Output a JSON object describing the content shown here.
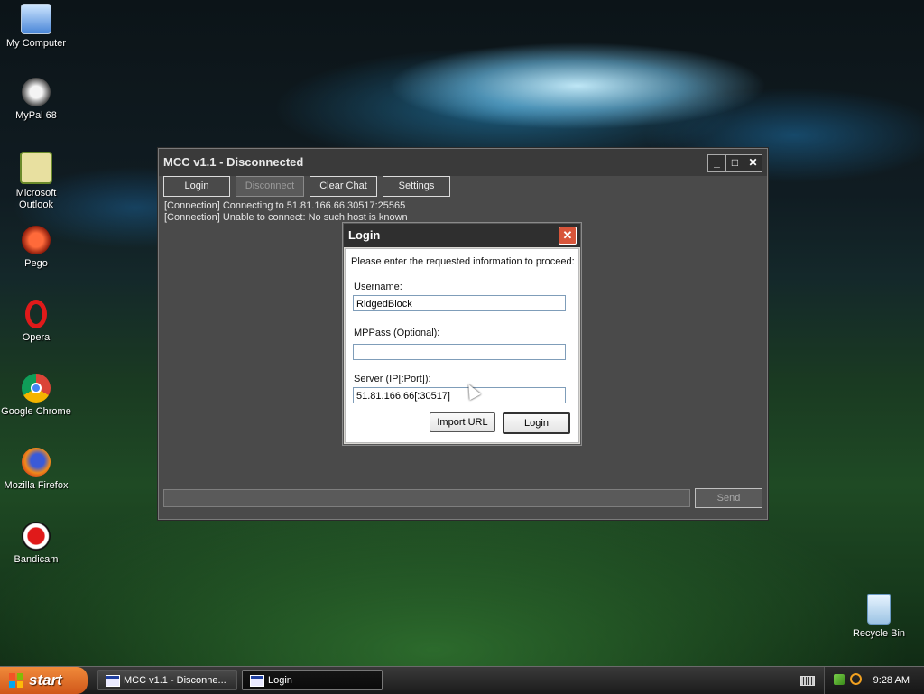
{
  "desktop": {
    "icons": [
      {
        "label": "My Computer"
      },
      {
        "label": "MyPal 68"
      },
      {
        "label": "Microsoft Outlook"
      },
      {
        "label": "Pego"
      },
      {
        "label": "Opera"
      },
      {
        "label": "Google Chrome"
      },
      {
        "label": "Mozilla Firefox"
      },
      {
        "label": "Bandicam"
      },
      {
        "label": "Recycle Bin"
      }
    ]
  },
  "mcc_window": {
    "title": "MCC v1.1 - Disconnected",
    "minimize": "_",
    "maximize": "□",
    "close": "✕",
    "toolbar": {
      "login": "Login",
      "disconnect": "Disconnect",
      "clear_chat": "Clear Chat",
      "settings": "Settings"
    },
    "log": [
      "[Connection] Connecting to 51.81.166.66:30517:25565",
      "[Connection] Unable to connect: No such host is known"
    ],
    "chat_input_value": "",
    "send": "Send"
  },
  "login_dialog": {
    "title": "Login",
    "close": "✕",
    "prompt": "Please enter the requested information to proceed:",
    "username_label": "Username:",
    "username_value": "RidgedBlock",
    "mppass_label": "MPPass (Optional):",
    "mppass_value": "",
    "server_label": "Server (IP[:Port]):",
    "server_value": "51.81.166.66[:30517]",
    "import_url": "Import URL",
    "login": "Login"
  },
  "taskbar": {
    "start": "start",
    "tasks": [
      {
        "label": "MCC v1.1 - Disconne...",
        "active": false
      },
      {
        "label": "Login",
        "active": true
      }
    ],
    "time": "9:28 AM"
  },
  "colors": {
    "start_orange": "#e06a26",
    "dialog_close_red": "#d8553a",
    "window_gray": "#4a4a4a"
  }
}
